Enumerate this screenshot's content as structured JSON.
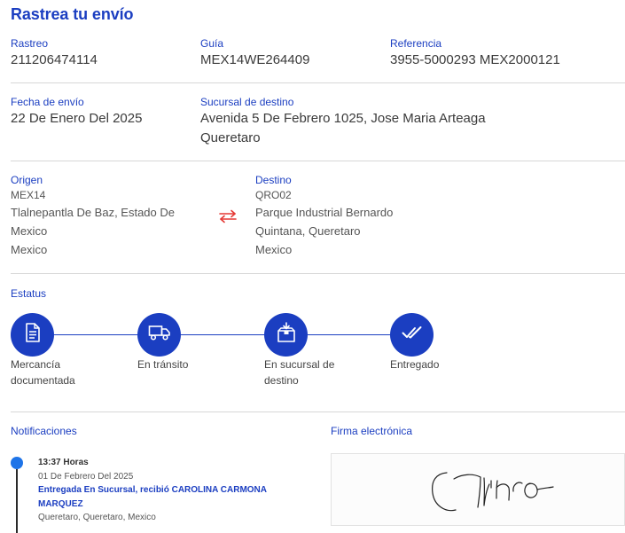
{
  "title": "Rastrea tu envío",
  "rastreo": {
    "label": "Rastreo",
    "value": "211206474114"
  },
  "guia": {
    "label": "Guía",
    "value": "MEX14WE264409"
  },
  "referencia": {
    "label": "Referencia",
    "value": "3955-5000293 MEX2000121"
  },
  "fecha_envio": {
    "label": "Fecha de envío",
    "value": "22 De Enero Del 2025"
  },
  "sucursal_destino": {
    "label": "Sucursal de destino",
    "line1": "Avenida 5 De Febrero 1025, Jose Maria Arteaga",
    "line2": "Queretaro"
  },
  "origen": {
    "label": "Origen",
    "code": "MEX14",
    "line1": "Tlalnepantla De Baz, Estado De",
    "line2": "Mexico",
    "country": "Mexico"
  },
  "destino": {
    "label": "Destino",
    "code": "QRO02",
    "line1": "Parque Industrial Bernardo",
    "line2": "Quintana, Queretaro",
    "country": "Mexico"
  },
  "estatus": {
    "label": "Estatus",
    "steps": [
      {
        "line1": "Mercancía",
        "line2": "documentada",
        "icon": "document-icon"
      },
      {
        "line1": "En tránsito",
        "line2": "",
        "icon": "truck-icon"
      },
      {
        "line1": "En sucursal de",
        "line2": "destino",
        "icon": "branch-box-icon"
      },
      {
        "line1": "Entregado",
        "line2": "",
        "icon": "double-check-icon"
      }
    ],
    "progress_steps_completed": 4
  },
  "notificaciones": {
    "label": "Notificaciones",
    "items": [
      {
        "time": "13:37 Horas",
        "date": "01 De Febrero Del 2025",
        "msg_line1": "Entregada En Sucursal, recibió CAROLINA CARMONA",
        "msg_line2": "MARQUEZ",
        "place": "Queretaro, Queretaro, Mexico"
      }
    ]
  },
  "firma": {
    "label": "Firma electrónica"
  },
  "colors": {
    "accent": "#1b3ec1",
    "swap_icon": "#e53935",
    "timeline_dot": "#1e74e8"
  }
}
